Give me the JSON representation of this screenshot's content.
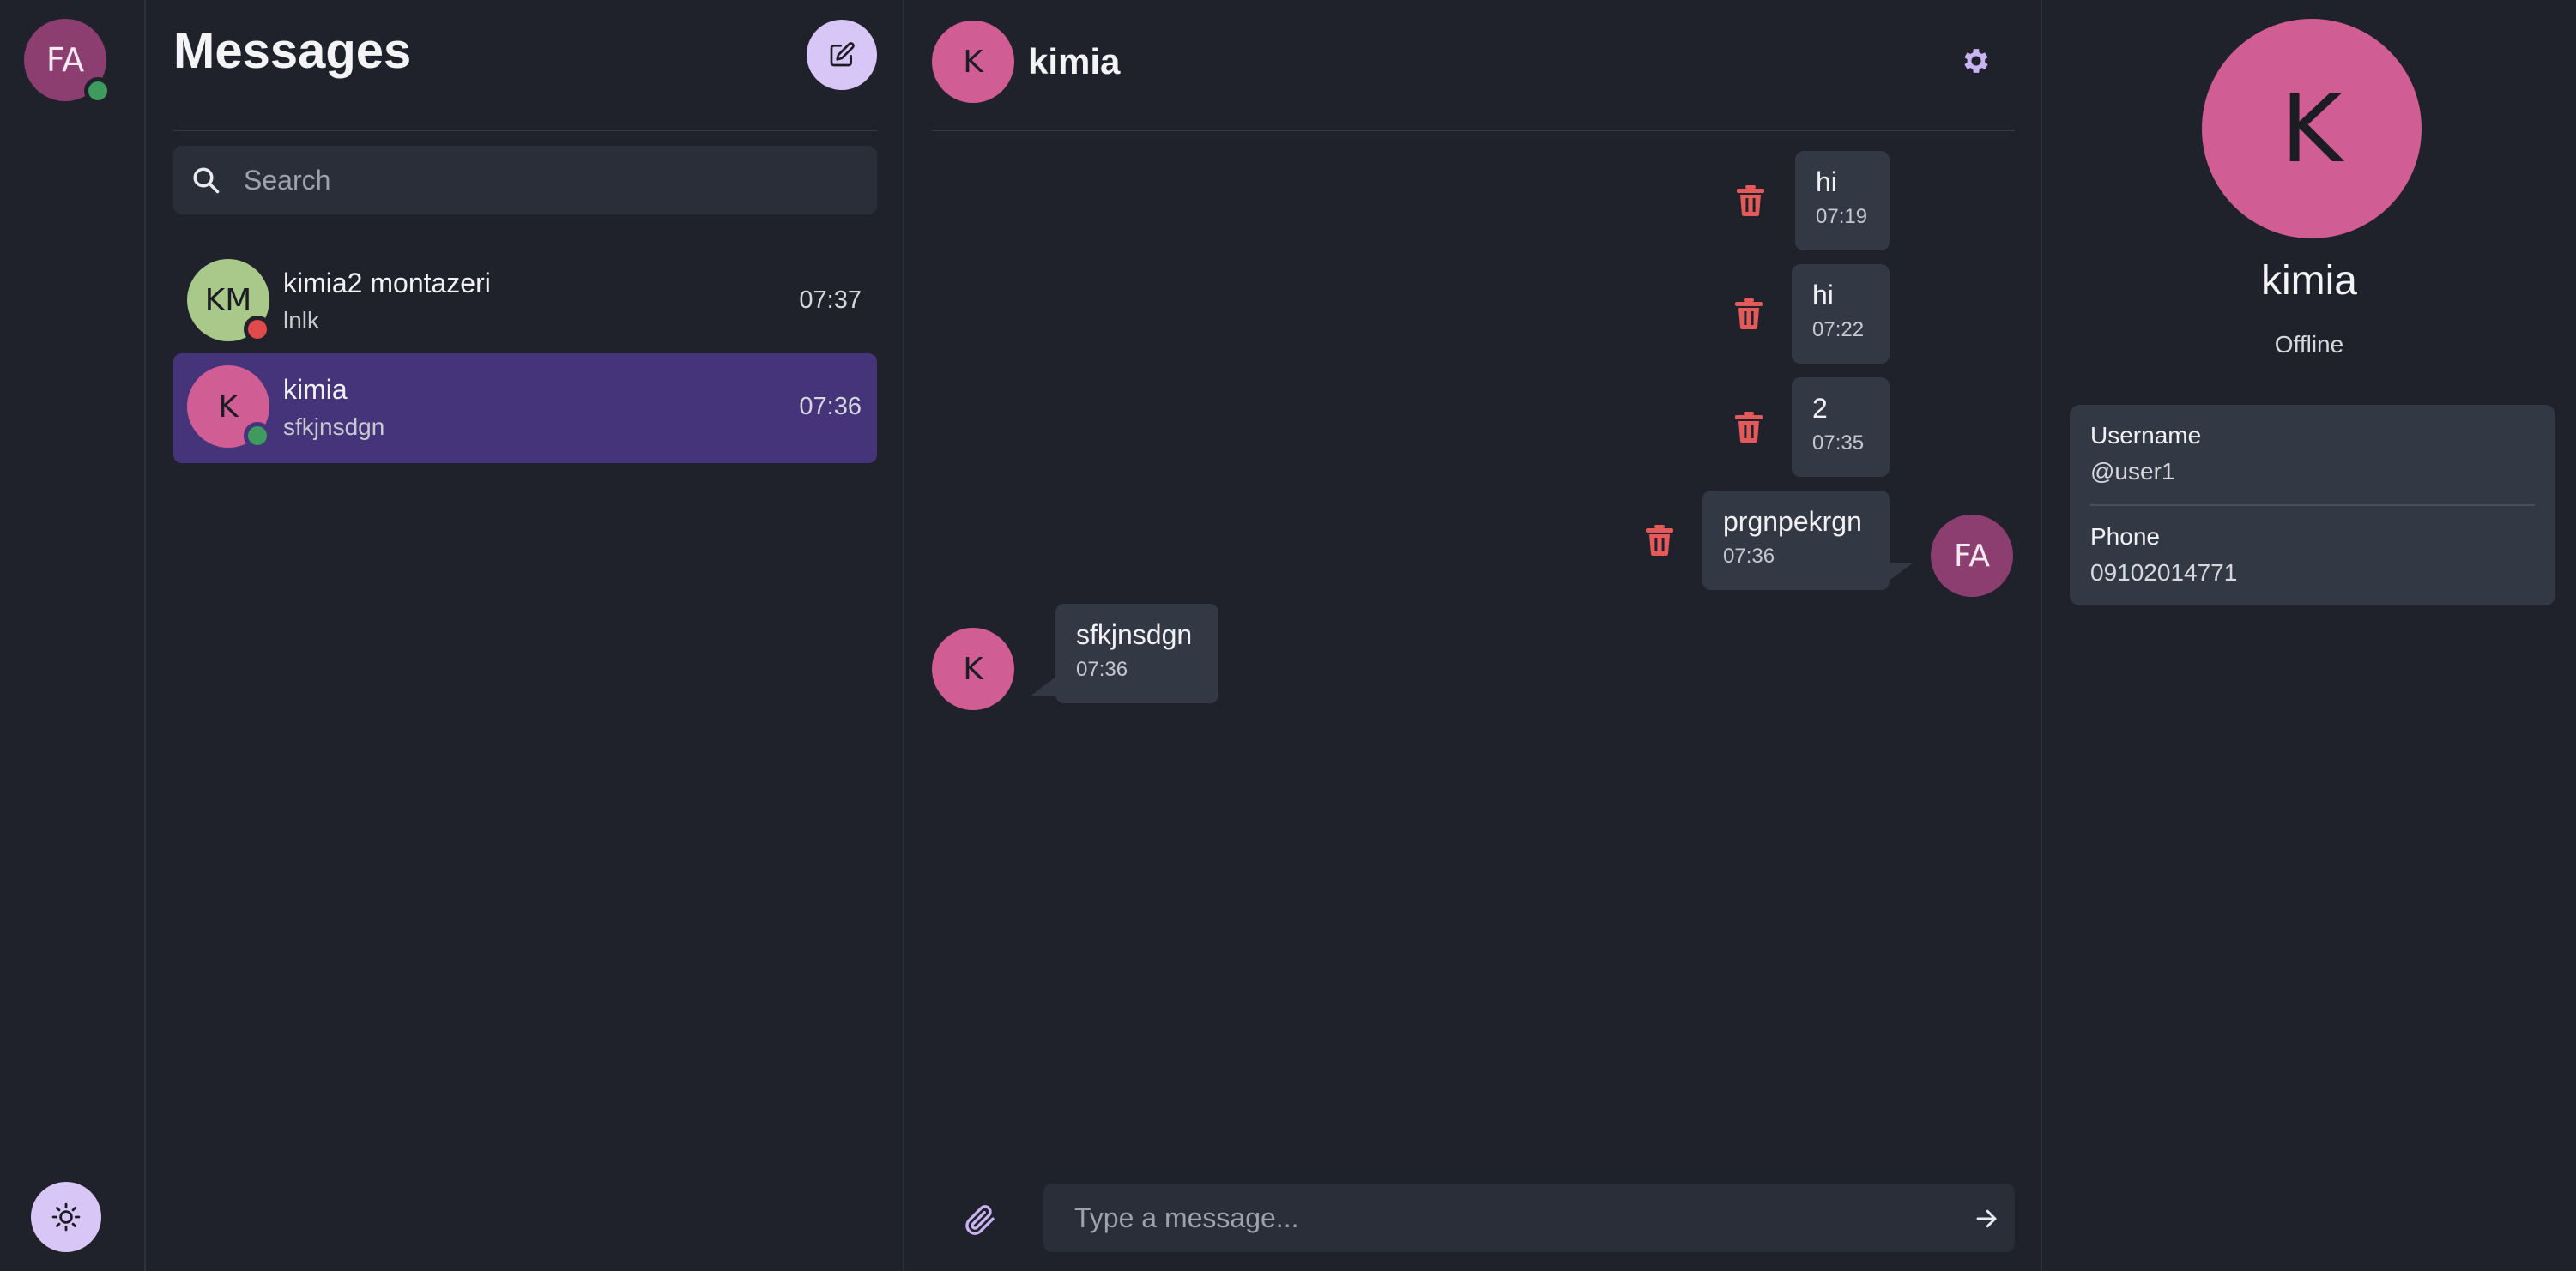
{
  "user": {
    "initials": "FA",
    "status_color": "#3f9a5e"
  },
  "list": {
    "title": "Messages",
    "search_placeholder": "Search",
    "conversations": [
      {
        "initials": "KM",
        "name": "kimia2 montazeri",
        "preview": "lnlk",
        "time": "07:37",
        "avatar_color": "#a8c98a",
        "status_color": "#e04a4a",
        "active": false
      },
      {
        "initials": "K",
        "name": "kimia",
        "preview": "sfkjnsdgn",
        "time": "07:36",
        "avatar_color": "#d15d95",
        "status_color": "#3f9a5e",
        "active": true
      }
    ]
  },
  "chat": {
    "contact_initials": "K",
    "contact_name": "kimia",
    "self_initials": "FA",
    "messages": [
      {
        "text": "hi",
        "time": "07:19",
        "outgoing": true
      },
      {
        "text": "hi",
        "time": "07:22",
        "outgoing": true
      },
      {
        "text": "2",
        "time": "07:35",
        "outgoing": true
      },
      {
        "text": "prgnpekrgn",
        "time": "07:36",
        "outgoing": true
      },
      {
        "text": "sfkjnsdgn",
        "time": "07:36",
        "outgoing": false
      }
    ],
    "input_placeholder": "Type a message..."
  },
  "profile": {
    "initials": "K",
    "name": "kimia",
    "status": "Offline",
    "username_label": "Username",
    "username": "@user1",
    "phone_label": "Phone",
    "phone": "09102014771"
  },
  "colors": {
    "background": "#1f222b",
    "accent": "#d8c6f7",
    "active_conversation": "#45347a",
    "bubble": "#333845",
    "danger": "#e45a5a"
  }
}
